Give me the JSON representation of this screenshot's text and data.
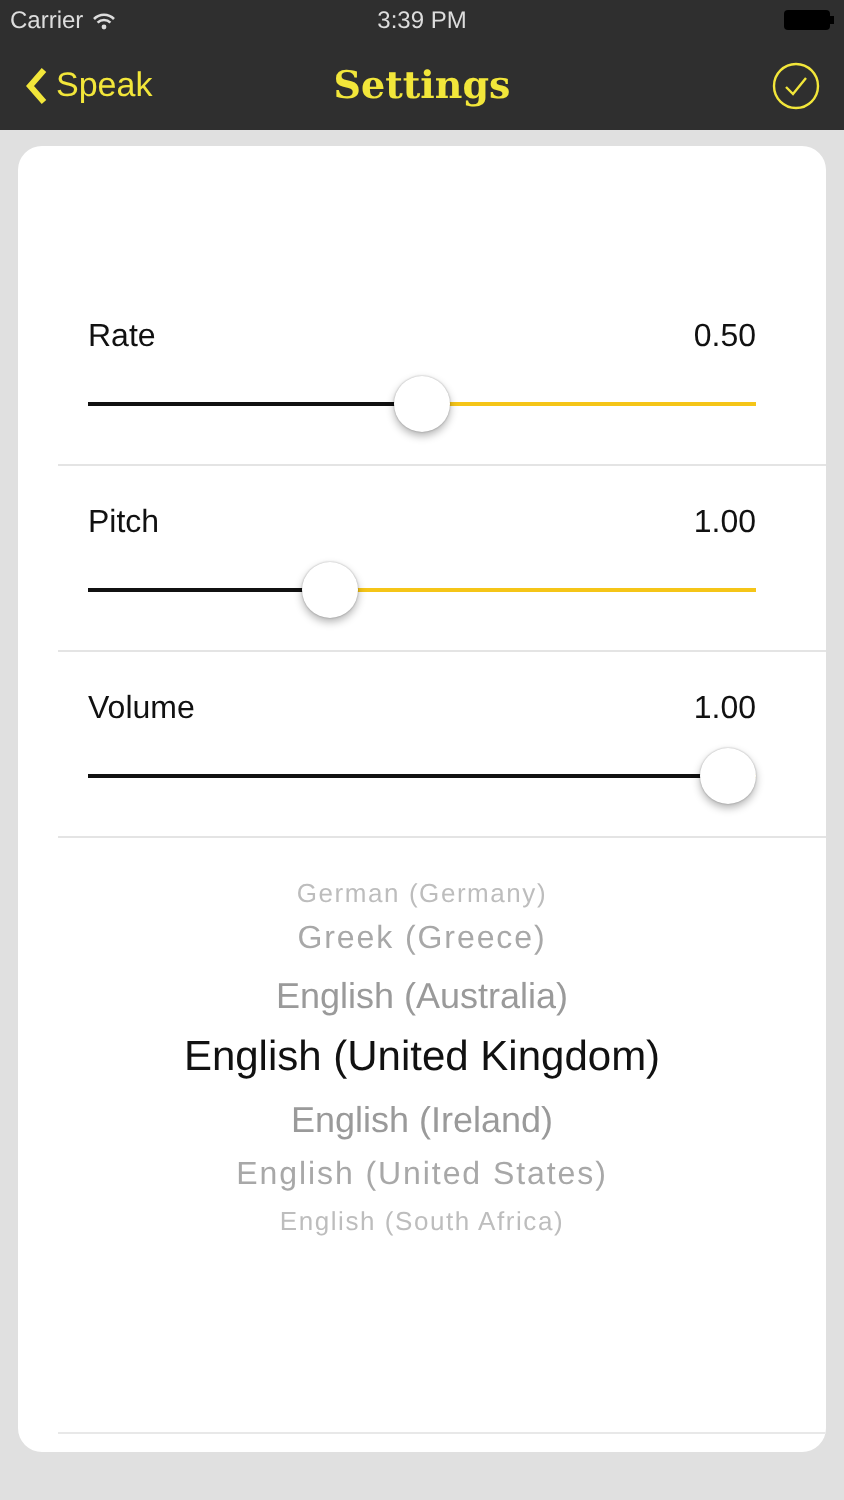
{
  "status_bar": {
    "carrier": "Carrier",
    "time": "3:39 PM"
  },
  "nav": {
    "back": "Speak",
    "title": "Settings"
  },
  "sliders": [
    {
      "label": "Rate",
      "reading": "0.50",
      "level": 0.5
    },
    {
      "label": "Pitch",
      "reading": "1.00",
      "level": 0.35
    },
    {
      "label": "Volume",
      "reading": "1.00",
      "level": 1
    }
  ],
  "voices": [
    {
      "label": "German (Germany)",
      "selected": false
    },
    {
      "label": "Greek (Greece)",
      "selected": false
    },
    {
      "label": "English (Australia)",
      "selected": false
    },
    {
      "label": "English (United Kingdom)",
      "selected": true
    },
    {
      "label": "English (Ireland)",
      "selected": false
    },
    {
      "label": "English (United States)",
      "selected": false
    },
    {
      "label": "English (South Africa)",
      "selected": false
    }
  ]
}
